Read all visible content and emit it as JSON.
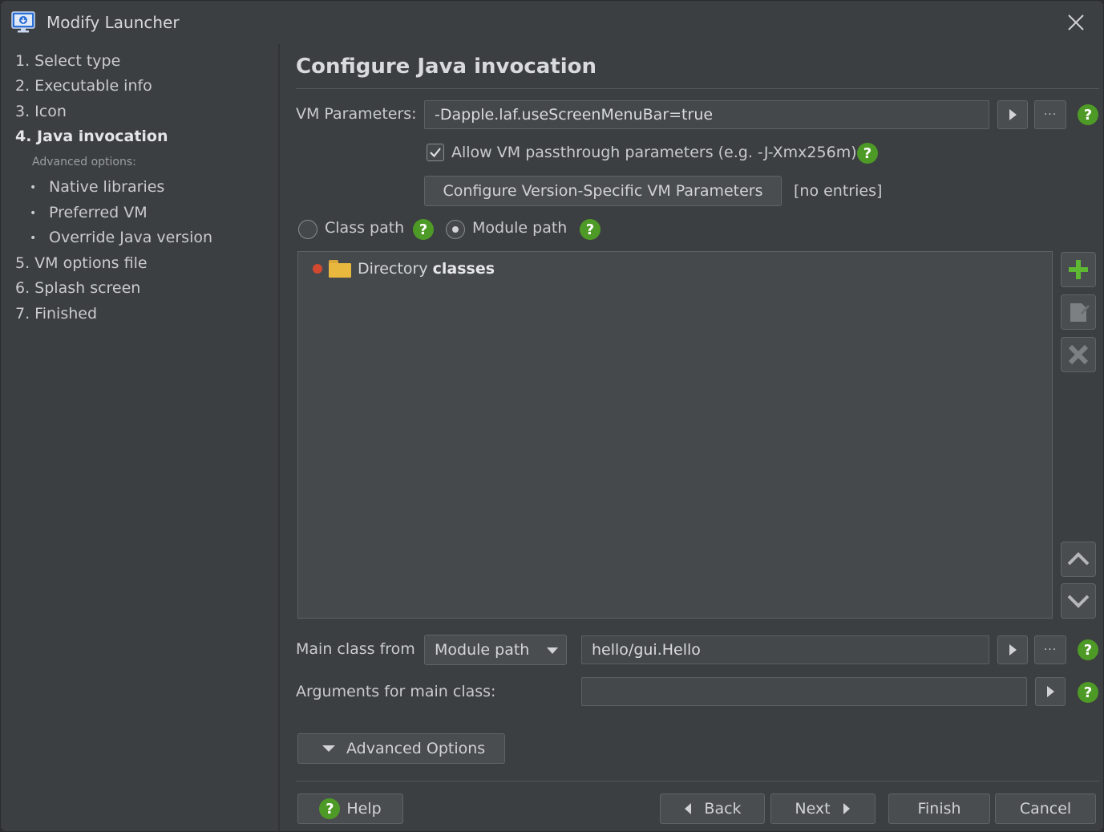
{
  "window": {
    "title": "Modify Launcher"
  },
  "sidebar": {
    "steps": [
      {
        "label": "1. Select type"
      },
      {
        "label": "2. Executable info"
      },
      {
        "label": "3. Icon"
      },
      {
        "label": "4. Java invocation",
        "active": true
      },
      {
        "label": "5. VM options file"
      },
      {
        "label": "6. Splash screen"
      },
      {
        "label": "7. Finished"
      }
    ],
    "advanced_label": "Advanced options:",
    "advanced_bullet": "•",
    "advanced_items": [
      {
        "label": "Native libraries"
      },
      {
        "label": "Preferred VM"
      },
      {
        "label": "Override Java version"
      }
    ]
  },
  "main": {
    "heading": "Configure Java invocation",
    "vm_params": {
      "label": "VM Parameters:",
      "value": "-Dapple.laf.useScreenMenuBar=true",
      "more": "···"
    },
    "passthrough": {
      "label": "Allow VM passthrough parameters (e.g. -J-Xmx256m)",
      "checked": true
    },
    "version_specific": {
      "button": "Configure Version-Specific VM Parameters",
      "status": "[no entries]"
    },
    "path_mode": {
      "class_path": "Class path",
      "module_path": "Module path",
      "selected": "module_path"
    },
    "entries": [
      {
        "type": "Directory",
        "name": "classes"
      }
    ],
    "main_class": {
      "label": "Main class from",
      "source": "Module path",
      "value": "hello/gui.Hello",
      "more": "···"
    },
    "arguments": {
      "label": "Arguments for main class:",
      "value": ""
    },
    "advanced_button": "Advanced Options",
    "help_glyph": "?"
  },
  "footer": {
    "help": "Help",
    "back": "Back",
    "next": "Next",
    "finish": "Finish",
    "cancel": "Cancel"
  },
  "colors": {
    "background": "#3c3f41",
    "help_green": "#4e9a27",
    "add_green": "#5fb832",
    "error_dot": "#d3492f",
    "folder": "#e8b83e"
  }
}
